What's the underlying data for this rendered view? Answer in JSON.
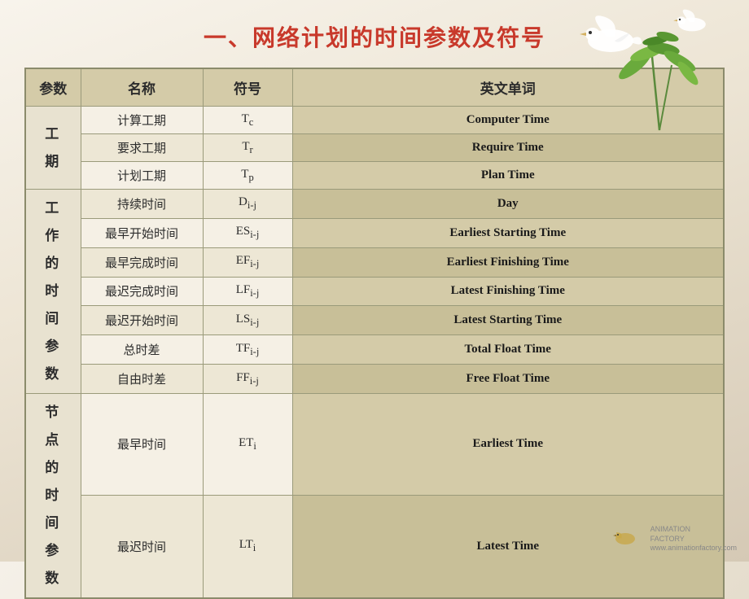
{
  "title": "一、网络计划的时间参数及符号",
  "table": {
    "headers": [
      "参数",
      "名称",
      "符号",
      "英文单词"
    ],
    "sections": [
      {
        "category": "工\n期",
        "rowspan": 3,
        "rows": [
          {
            "name": "计算工期",
            "symbol_html": "T<sub>c</sub>",
            "english": "Computer Time"
          },
          {
            "name": "要求工期",
            "symbol_html": "T<sub>r</sub>",
            "english": "Require Time"
          },
          {
            "name": "计划工期",
            "symbol_html": "T<sub>p</sub>",
            "english": "Plan Time"
          }
        ]
      },
      {
        "category": "工\n作\n的\n时\n间\n参\n数",
        "rowspan": 6,
        "rows": [
          {
            "name": "持续时间",
            "symbol_html": "D<sub>i-j</sub>",
            "english": "Day"
          },
          {
            "name": "最早开始时间",
            "symbol_html": "ES<sub>i-j</sub>",
            "english": "Earliest Starting Time"
          },
          {
            "name": "最早完成时间",
            "symbol_html": "EF<sub>i-j</sub>",
            "english": "Earliest Finishing Time"
          },
          {
            "name": "最迟完成时间",
            "symbol_html": "LF<sub>i-j</sub>",
            "english": "Latest Finishing Time"
          },
          {
            "name": "最迟开始时间",
            "symbol_html": "LS<sub>i-j</sub>",
            "english": "Latest Starting Time"
          },
          {
            "name": "总时差",
            "symbol_html": "TF<sub>i-j</sub>",
            "english": "Total Float Time"
          },
          {
            "name": "自由时差",
            "symbol_html": "FF<sub>i-j</sub>",
            "english": "Free Float Time"
          }
        ]
      },
      {
        "category": "节\n点\n的\n时\n间\n参\n数",
        "rowspan": 2,
        "rows": [
          {
            "name": "最早时间",
            "symbol_html": "ET<sub>i</sub>",
            "english": "Earliest Time"
          },
          {
            "name": "最迟时间",
            "symbol_html": "LT<sub>i</sub>",
            "english": "Latest Time"
          }
        ]
      }
    ]
  },
  "logo": {
    "line1": "ANIMATION",
    "line2": "FACTORY",
    "line3": "www.animationfactory.com"
  }
}
